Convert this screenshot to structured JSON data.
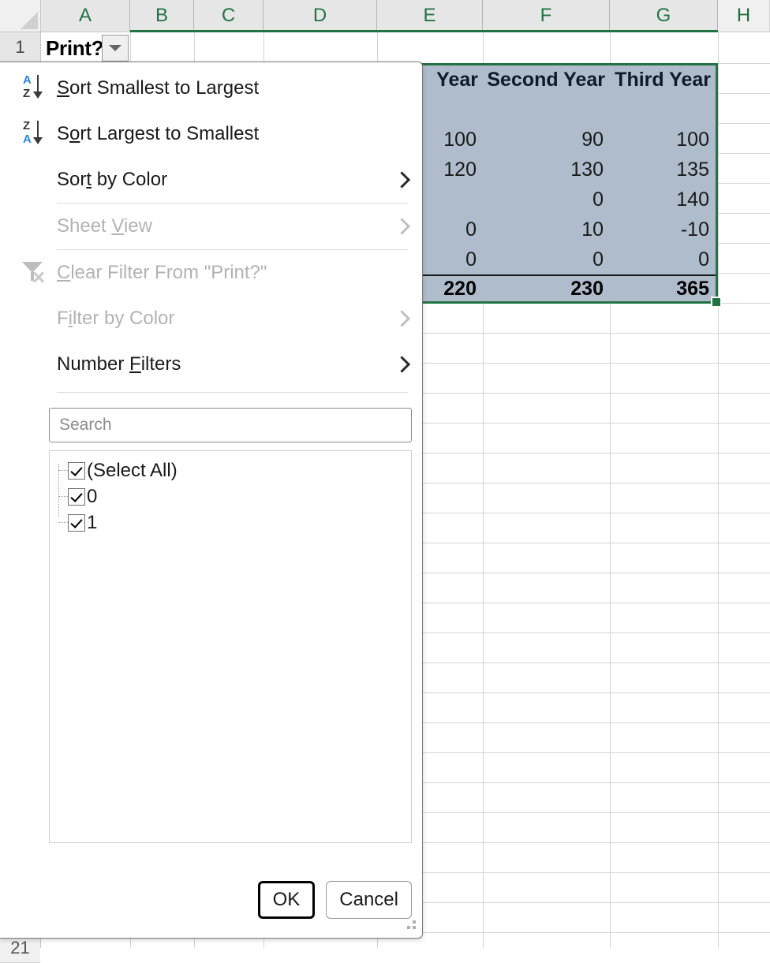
{
  "app": "excel-autofilter-dropdown",
  "sheet": {
    "column_headers": [
      "A",
      "B",
      "C",
      "D",
      "E",
      "F",
      "G",
      "H"
    ],
    "row_headers": [
      "1",
      "21"
    ],
    "active_cell": {
      "ref": "A1",
      "value": "Print?",
      "has_filter_button": true
    },
    "selection": {
      "headers": [
        "Year",
        "Second Year",
        "Third Year"
      ],
      "rows": [
        [
          "",
          "",
          ""
        ],
        [
          "100",
          "90",
          "100"
        ],
        [
          "120",
          "130",
          "135"
        ],
        [
          "",
          "0",
          "140"
        ],
        [
          "0",
          "10",
          "-10"
        ],
        [
          "0",
          "0",
          "0"
        ]
      ],
      "totals": [
        "220",
        "230",
        "365"
      ]
    }
  },
  "filter_menu": {
    "items": [
      {
        "label": "Sort Smallest to Largest",
        "accel": "S",
        "icon": "sort-az-icon",
        "disabled": false,
        "submenu": false
      },
      {
        "label": "Sort Largest to Smallest",
        "accel": "o",
        "icon": "sort-za-icon",
        "disabled": false,
        "submenu": false
      },
      {
        "label": "Sort by Color",
        "accel": "t",
        "icon": "none",
        "disabled": false,
        "submenu": true
      },
      {
        "label": "Sheet View",
        "accel": "V",
        "icon": "none",
        "disabled": true,
        "submenu": true
      },
      {
        "label": "Clear Filter From \"Print?\"",
        "accel": "C",
        "icon": "clear-filter-icon",
        "disabled": true,
        "submenu": false
      },
      {
        "label": "Filter by Color",
        "accel": "i",
        "icon": "none",
        "disabled": true,
        "submenu": true
      },
      {
        "label": "Number Filters",
        "accel": "F",
        "icon": "none",
        "disabled": false,
        "submenu": true
      }
    ],
    "search": {
      "placeholder": "Search",
      "value": ""
    },
    "value_list": [
      {
        "label": "(Select All)",
        "checked": true,
        "level": 0
      },
      {
        "label": "0",
        "checked": true,
        "level": 1
      },
      {
        "label": "1",
        "checked": true,
        "level": 1
      }
    ],
    "buttons": {
      "ok": "OK",
      "cancel": "Cancel"
    }
  },
  "colors": {
    "excel_green": "#217346",
    "selection_fill": "#aebccb",
    "accent_blue": "#2b88d8"
  }
}
